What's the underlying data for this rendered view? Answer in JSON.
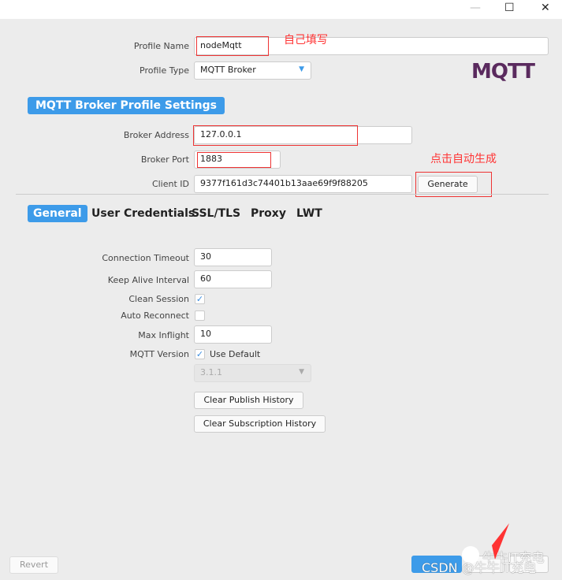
{
  "window": {
    "minimize": "—",
    "maximize": "☐",
    "close": "✕"
  },
  "profile": {
    "name_label": "Profile Name",
    "name_value": "nodeMqtt",
    "type_label": "Profile Type",
    "type_value": "MQTT Broker",
    "logo": "MQTT"
  },
  "annotations": {
    "fill_self": "自己填写",
    "click_generate": "点击自动生成"
  },
  "section_title": "MQTT Broker Profile Settings",
  "broker": {
    "address_label": "Broker Address",
    "address_value": "127.0.0.1",
    "port_label": "Broker Port",
    "port_value": "1883",
    "client_id_label": "Client ID",
    "client_id_value": "9377f161d3c74401b13aae69f9f88205",
    "generate": "Generate"
  },
  "tabs": [
    "General",
    "User Credentials",
    "SSL/TLS",
    "Proxy",
    "LWT"
  ],
  "general": {
    "conn_timeout_label": "Connection Timeout",
    "conn_timeout": "30",
    "keep_alive_label": "Keep Alive Interval",
    "keep_alive": "60",
    "clean_session_label": "Clean Session",
    "clean_session": true,
    "auto_reconnect_label": "Auto Reconnect",
    "auto_reconnect": false,
    "max_inflight_label": "Max Inflight",
    "max_inflight": "10",
    "mqtt_version_label": "MQTT Version",
    "use_default_label": "Use Default",
    "use_default": true,
    "version_value": "3.1.1",
    "clear_publish": "Clear Publish History",
    "clear_subscription": "Clear Subscription History"
  },
  "footer": {
    "revert": "Revert"
  },
  "watermark": {
    "line1": "牛牛IT充电",
    "line2": "CSDN @牛牛IT充电"
  },
  "colors": {
    "accent": "#3d9be9",
    "annotation": "#ff3333"
  }
}
